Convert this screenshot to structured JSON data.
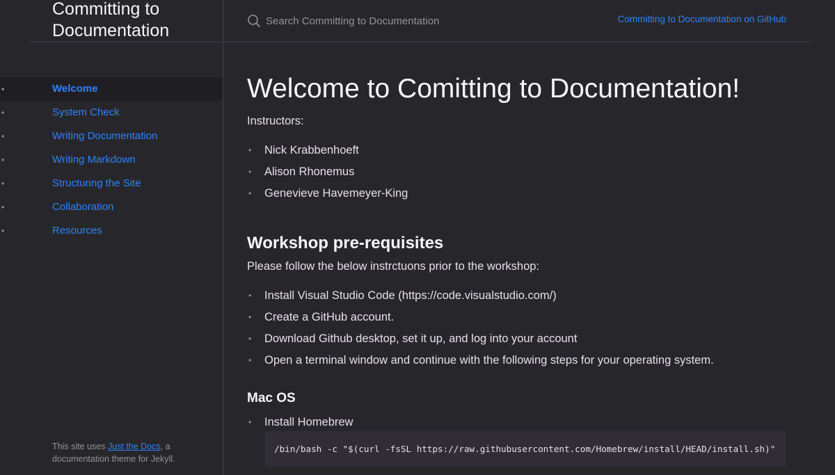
{
  "sidebar": {
    "site_title": "Committing to Documentation",
    "nav_items": [
      {
        "label": "Welcome"
      },
      {
        "label": "System Check"
      },
      {
        "label": "Writing Documentation"
      },
      {
        "label": "Writing Markdown"
      },
      {
        "label": "Structuring the Site"
      },
      {
        "label": "Collaboration"
      },
      {
        "label": "Resources"
      }
    ],
    "active_item": "Welcome",
    "footer": {
      "prefix": "This site uses ",
      "link_label": "Just the Docs",
      "suffix": ", a documentation theme for Jekyll."
    }
  },
  "header": {
    "search_placeholder": "Search Committing to Documentation",
    "github_link": "Committing to Documentation on GitHub",
    "search_icon": "search-icon"
  },
  "main": {
    "title": "Welcome to Comitting to Documentation!",
    "instructors_label": "Instructors:",
    "instructors": [
      "Nick Krabbenhoeft",
      "Alison Rhonemus",
      "Genevieve Havemeyer-King"
    ],
    "prereq_heading": "Workshop pre-requisites",
    "prereq_intro": "Please follow the below instrctuons prior to the workshop:",
    "prereq_items": [
      "Install Visual Studio Code (https://code.visualstudio.com/)",
      "Create a GitHub account.",
      "Download Github desktop, set it up, and log into your account",
      "Open a terminal window and continue with the following steps for your operating system."
    ],
    "mac_heading": "Mac OS",
    "mac_items": [
      "Install Homebrew"
    ],
    "mac_code": "/bin/bash -c \"$(curl -fsSL https://raw.githubusercontent.com/Homebrew/install/HEAD/install.sh)\""
  },
  "colors": {
    "background": "#27262b",
    "link": "#2c84fa",
    "text": "#e6e1e8",
    "border": "#44434d",
    "code_bg": "#302d36"
  }
}
